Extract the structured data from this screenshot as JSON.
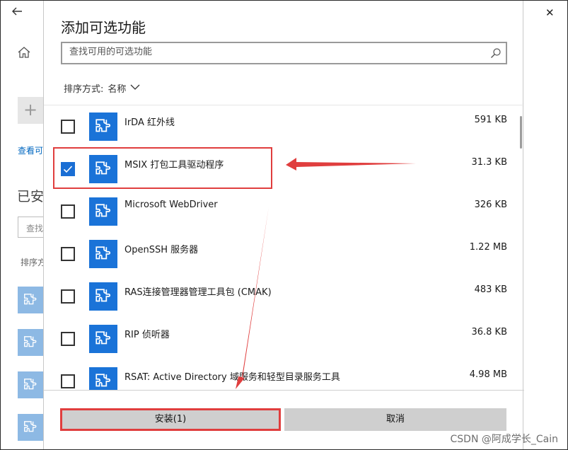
{
  "window": {
    "back_icon": "back-arrow-icon",
    "minimize": "─",
    "maximize": "☐",
    "close": "✕"
  },
  "background": {
    "home_icon": "home-icon",
    "add_icon": "+",
    "link_text": "查看可",
    "heading": "已安",
    "search_placeholder": "查找",
    "sort_text": "排序方"
  },
  "dialog": {
    "title": "添加可选功能",
    "search_placeholder": "查找可用的可选功能",
    "sort_label": "排序方式:",
    "sort_value": "名称",
    "features": [
      {
        "name": "IrDA 红外线",
        "size": "591 KB",
        "checked": false
      },
      {
        "name": "MSIX 打包工具驱动程序",
        "size": "31.3 KB",
        "checked": true
      },
      {
        "name": "Microsoft WebDriver",
        "size": "326 KB",
        "checked": false
      },
      {
        "name": "OpenSSH 服务器",
        "size": "1.22 MB",
        "checked": false
      },
      {
        "name": "RAS连接管理器管理工具包 (CMAK)",
        "size": "483 KB",
        "checked": false
      },
      {
        "name": "RIP 侦听器",
        "size": "36.8 KB",
        "checked": false
      },
      {
        "name": "RSAT: Active Directory 域服务和轻型目录服务工具",
        "size": "4.98 MB",
        "checked": false
      }
    ],
    "install_button": "安装(1)",
    "cancel_button": "取消"
  },
  "colors": {
    "accent": "#1a73d8",
    "annotation": "#e03e3e"
  },
  "watermark": "CSDN @阿成学长_Cain"
}
